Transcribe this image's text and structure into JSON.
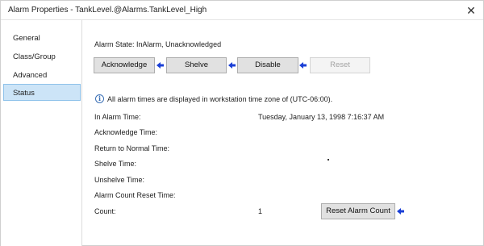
{
  "window": {
    "title": "Alarm Properties - TankLevel.@Alarms.TankLevel_High",
    "close_glyph": "✕"
  },
  "sidebar": {
    "items": [
      {
        "label": "General"
      },
      {
        "label": "Class/Group"
      },
      {
        "label": "Advanced"
      },
      {
        "label": "Status",
        "active": true
      }
    ]
  },
  "status": {
    "alarm_state": "Alarm State: InAlarm, Unacknowledged",
    "buttons": {
      "acknowledge": "Acknowledge",
      "shelve": "Shelve",
      "disable": "Disable",
      "reset": "Reset"
    },
    "info_icon": "info-icon",
    "info_text": "All alarm times are displayed in workstation time zone of (UTC-06:00).",
    "fields": {
      "in_alarm_time": {
        "label": "In Alarm Time:",
        "value": "Tuesday, January 13, 1998 7:16:37 AM"
      },
      "acknowledge_time": {
        "label": "Acknowledge Time:",
        "value": ""
      },
      "return_to_normal_time": {
        "label": "Return to Normal Time:",
        "value": ""
      },
      "shelve_time": {
        "label": "Shelve Time:",
        "value": ""
      },
      "unshelve_time": {
        "label": "Unshelve Time:",
        "value": ""
      },
      "alarm_count_reset_time": {
        "label": "Alarm Count Reset Time:",
        "value": ""
      },
      "count": {
        "label": "Count:",
        "value": "1"
      }
    },
    "reset_alarm_count_label": "Reset Alarm Count"
  },
  "colors": {
    "active_nav_bg": "#cce4f7",
    "arrow": "#1a3fd6",
    "button_bg": "#e1e1e1"
  }
}
